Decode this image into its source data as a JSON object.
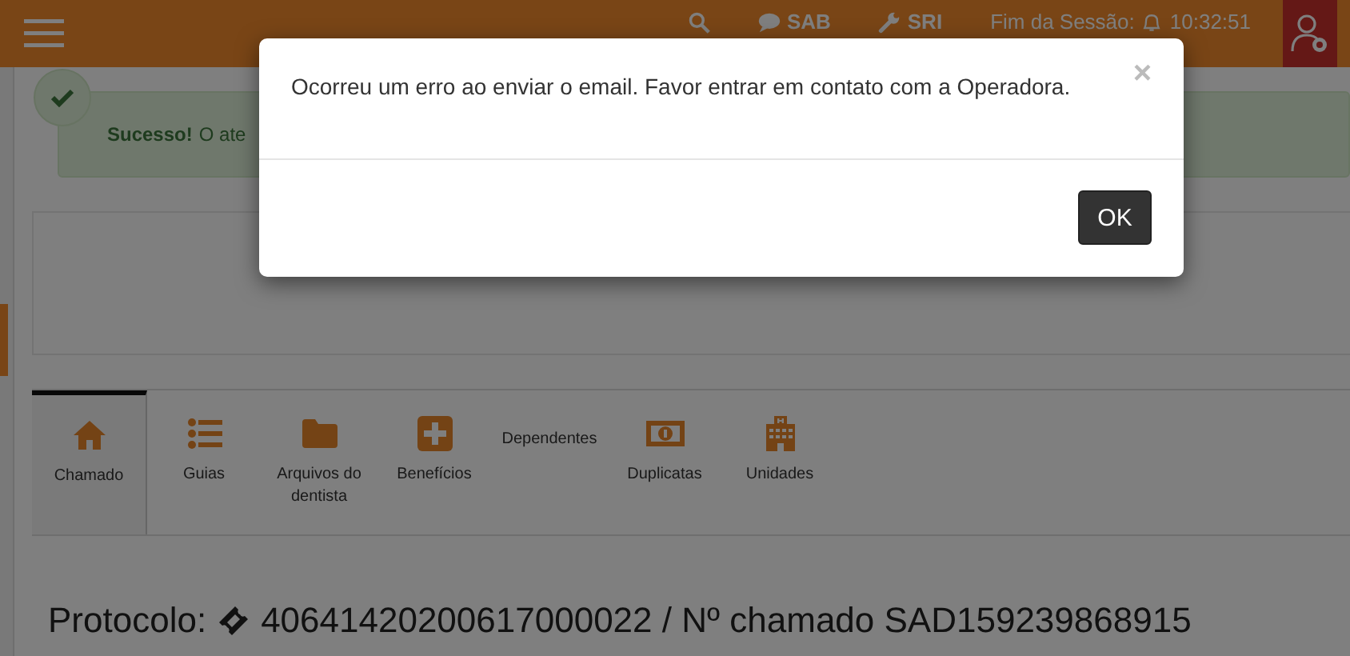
{
  "header": {
    "items": [
      {
        "kind": "search"
      },
      {
        "kind": "chat",
        "label": "SAB"
      },
      {
        "kind": "wrench",
        "label": "SRI"
      }
    ],
    "session_label": "Fim da Sessão:",
    "session_time": "10:32:51"
  },
  "alert": {
    "title": "Sucesso!",
    "text": "O ate"
  },
  "tabs": [
    {
      "label": "Chamado",
      "kind": "icon",
      "selected": true
    },
    {
      "label": "Guias",
      "kind": "icon",
      "selected": false
    },
    {
      "label": "Arquivos do dentista",
      "kind": "icon",
      "selected": false
    },
    {
      "label": "Benefícios",
      "kind": "icon",
      "selected": false
    },
    {
      "label": "Dependentes",
      "kind": "text",
      "selected": false
    },
    {
      "label": "Duplicatas",
      "kind": "icon",
      "selected": false
    },
    {
      "label": "Unidades",
      "kind": "icon",
      "selected": false
    }
  ],
  "protocol": {
    "label": "Protocolo:",
    "number": "40641420200617000022 / Nº chamado SAD159239868915"
  },
  "modal": {
    "message": "Ocorreu um erro ao enviar o email. Favor entrar em contato com a Operadora.",
    "close": "×",
    "button": "OK"
  }
}
